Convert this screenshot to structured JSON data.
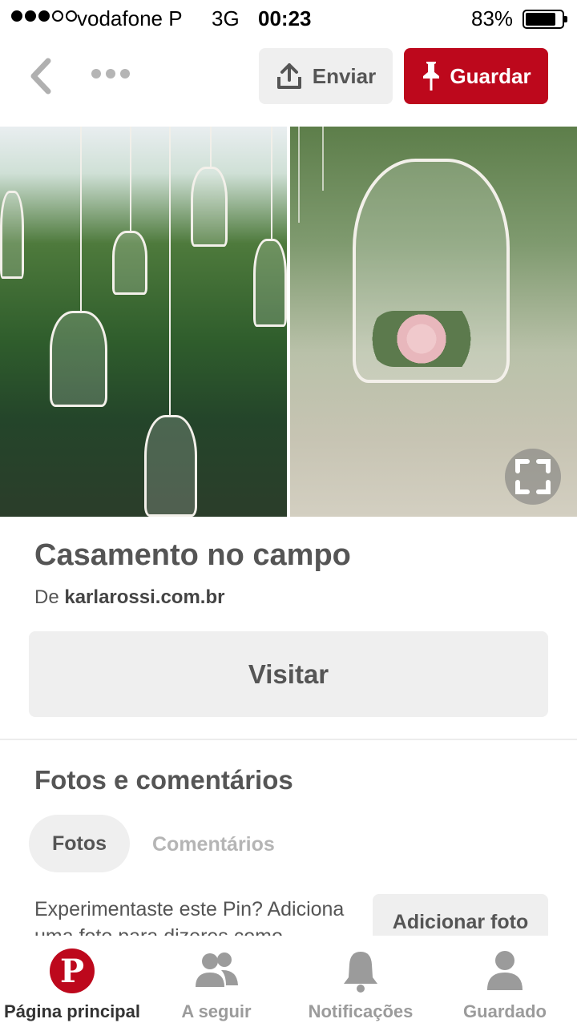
{
  "status_bar": {
    "carrier": "vodafone P",
    "network": "3G",
    "time": "00:23",
    "battery_percent": "83%",
    "battery_level": 0.83,
    "signal_bars_filled": 3,
    "signal_bars_total": 5
  },
  "toolbar": {
    "back_icon": "chevron-left-icon",
    "more_icon": "ellipsis-icon",
    "send_label": "Enviar",
    "send_icon": "upload-icon",
    "save_label": "Guardar",
    "save_icon": "pin-icon"
  },
  "colors": {
    "brand_red": "#bd081c",
    "button_gray": "#efefef",
    "text_dark": "#555555",
    "text_muted": "#9b9b9b"
  },
  "pin": {
    "title": "Casamento no campo",
    "source_prefix": "De",
    "source_domain": "karlarossi.com.br",
    "expand_icon": "expand-icon",
    "visit_label": "Visitar"
  },
  "photos_comments": {
    "section_title": "Fotos e comentários",
    "tab_photos": "Fotos",
    "tab_comments": "Comentários",
    "prompt_text": "Experimentaste este Pin? Adiciona uma foto para dizeres como",
    "add_photo_label": "Adicionar foto"
  },
  "bottom_nav": {
    "items": [
      {
        "label": "Página principal",
        "icon": "pinterest-logo-icon",
        "active": true
      },
      {
        "label": "A seguir",
        "icon": "people-icon",
        "active": false
      },
      {
        "label": "Notificações",
        "icon": "bell-icon",
        "active": false
      },
      {
        "label": "Guardado",
        "icon": "person-icon",
        "active": false
      }
    ]
  }
}
